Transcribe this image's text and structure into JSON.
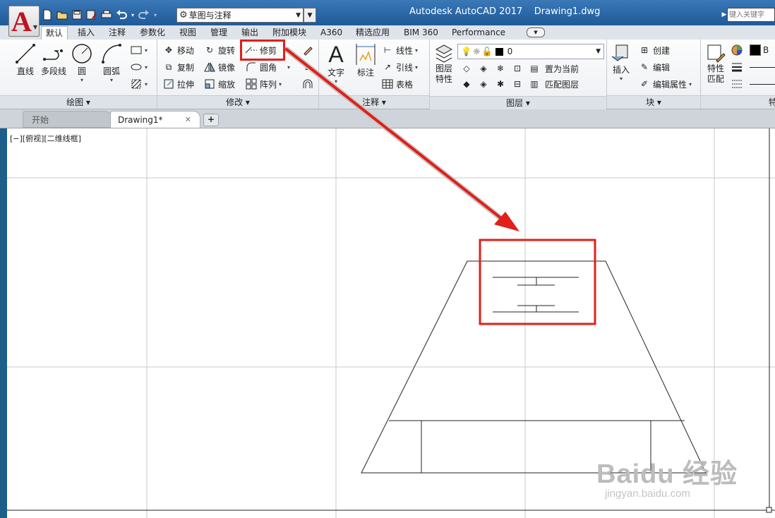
{
  "app": {
    "window_title": "Autodesk AutoCAD 2017    Drawing1.dwg",
    "workspace": "草图与注释",
    "search_placeholder": "键入关键字"
  },
  "ribbon_tabs": [
    "默认",
    "插入",
    "注释",
    "参数化",
    "视图",
    "管理",
    "输出",
    "附加模块",
    "A360",
    "精选应用",
    "BIM 360",
    "Performance"
  ],
  "panels": {
    "draw": {
      "title": "绘图",
      "line": "直线",
      "polyline": "多段线",
      "circle": "圆",
      "arc": "圆弧"
    },
    "modify": {
      "title": "修改",
      "move": "移动",
      "rotate": "旋转",
      "trim": "修剪",
      "copy": "复制",
      "mirror": "镜像",
      "fillet": "圆角",
      "stretch": "拉伸",
      "scale": "缩放",
      "array": "阵列"
    },
    "annotation": {
      "title": "注释",
      "text": "文字",
      "dimension": "标注",
      "linear": "线性",
      "leader": "引线",
      "table": "表格"
    },
    "layers": {
      "title": "图层",
      "layer_properties": "图层\n特性",
      "current_layer": "0",
      "make_current": "置为当前",
      "match_layer": "匹配图层"
    },
    "block": {
      "title": "块",
      "insert": "插入",
      "create": "创建",
      "edit": "编辑",
      "edit_attributes": "编辑属性"
    },
    "properties": {
      "title": "特",
      "match_properties": "特性\n匹配",
      "color_label": "B"
    }
  },
  "doc_tabs": {
    "start": "开始",
    "drawing": "Drawing1*",
    "close": "✕",
    "add": "+"
  },
  "viewport_label": "[−][俯视][二维线框]",
  "watermark": {
    "line1": "Baidu 经验",
    "line2": "jingyan.baidu.com"
  },
  "colors": {
    "title_bar": "#2a69aa",
    "highlight": "#e0201a",
    "canvas": "#ffffff"
  }
}
